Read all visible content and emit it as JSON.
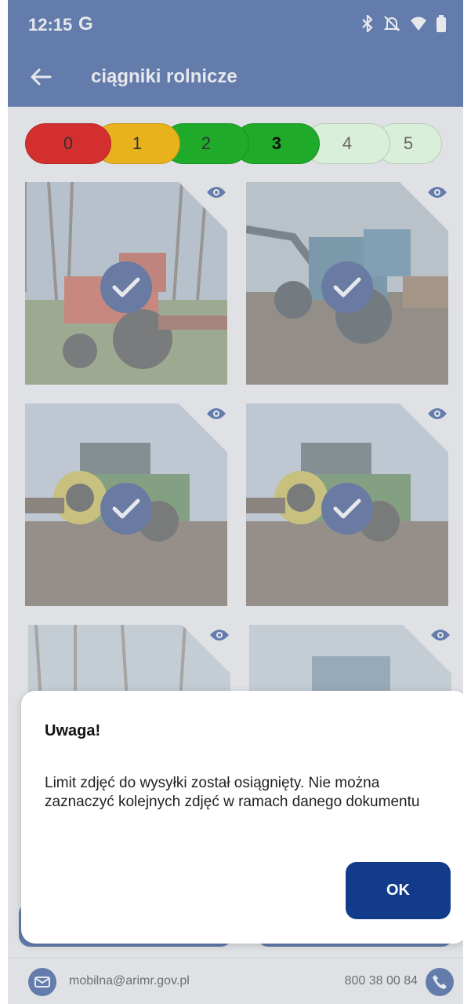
{
  "status_bar": {
    "time": "12:15",
    "g_logo": "G",
    "icons": [
      "bluetooth-icon",
      "silent-icon",
      "wifi-icon",
      "battery-icon"
    ]
  },
  "app_bar": {
    "title": "ciągniki rolnicze",
    "back_icon": "back-arrow-icon"
  },
  "rating": {
    "selected": "3",
    "segments": [
      {
        "label": "0",
        "color": "#d32f2f"
      },
      {
        "label": "1",
        "color": "#e8b21c"
      },
      {
        "label": "2",
        "color": "#1faa2a"
      },
      {
        "label": "3",
        "color": "#1faa2a"
      },
      {
        "label": "4",
        "color": "#cfe8cf"
      },
      {
        "label": "5",
        "color": "#cfe8cf"
      }
    ]
  },
  "photos": [
    {
      "name": "photo-red-tractor",
      "selected": true
    },
    {
      "name": "photo-green-tractor-loader",
      "selected": true
    },
    {
      "name": "photo-john-deere-1",
      "selected": true
    },
    {
      "name": "photo-john-deere-2",
      "selected": true
    },
    {
      "name": "photo-red-tractor-2",
      "selected": false
    },
    {
      "name": "photo-green-tractor-loader-2",
      "selected": false
    }
  ],
  "dialog": {
    "title": "Uwaga!",
    "message": "Limit zdjęć do wysyłki został osiągnięty. Nie można zaznaczyć kolejnych zdjęć w ramach danego dokumentu",
    "ok_label": "OK"
  },
  "footer": {
    "email": "mobilna@arimr.gov.pl",
    "phone": "800 38 00 84"
  },
  "colors": {
    "primary": "#123b8a",
    "check_bg": "#1e3a7a",
    "scrim": "rgba(200,205,212,0.45)"
  }
}
